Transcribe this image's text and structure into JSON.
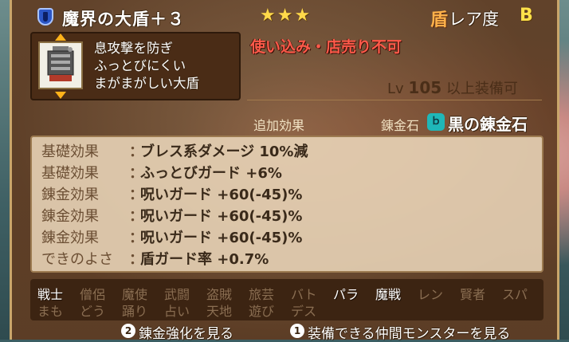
{
  "header": {
    "item_name": "魔界の大盾＋３",
    "stars": "★★★",
    "category_kanji": "盾",
    "rarity_label": "レア度",
    "rarity_value": "B"
  },
  "item": {
    "description": [
      "息攻撃を防ぎ",
      "ふっとびにくい",
      "まがまがしい大盾"
    ]
  },
  "warning": "使い込み・店売り不可",
  "level_requirement": {
    "prefix": "Lv",
    "level": "105",
    "suffix": "以上装備可"
  },
  "additional_effects_header": "追加効果",
  "alchemy_stone": {
    "label": "錬金石",
    "name": "黒の錬金石",
    "icon": "alchemy-stone-icon",
    "icon_glyph": "ｂ"
  },
  "effects": [
    {
      "label": "基礎効果",
      "value": "ブレス系ダメージ 10%減"
    },
    {
      "label": "基礎効果",
      "value": "ふっとびガード +6%"
    },
    {
      "label": "錬金効果",
      "value": "呪いガード +60(-45)%"
    },
    {
      "label": "錬金効果",
      "value": "呪いガード +60(-45)%"
    },
    {
      "label": "錬金効果",
      "value": "呪いガード +60(-45)%"
    },
    {
      "label": "できのよさ",
      "value": "盾ガード率 +0.7%"
    }
  ],
  "effect_colon": "：",
  "jobs": {
    "row1": [
      "戦士",
      "僧侶",
      "魔使",
      "武闘",
      "盗賊",
      "旅芸",
      "バト",
      "パラ",
      "魔戦",
      "レン",
      "賢者",
      "スパ"
    ],
    "row2": [
      "まも",
      "どう",
      "踊り",
      "占い",
      "天地",
      "遊び",
      "デス"
    ],
    "equippable": [
      "戦士",
      "パラ",
      "魔戦"
    ]
  },
  "footer": {
    "btn1_key": "2",
    "btn1_label": "錬金強化を見る",
    "btn2_key": "1",
    "btn2_label": "装備できる仲間モンスターを見る"
  },
  "colors": {
    "panel": "#6f4627",
    "warning": "#ff5a4a",
    "stars": "#ffd94a",
    "alchemy_icon": "#1fb7b8"
  }
}
